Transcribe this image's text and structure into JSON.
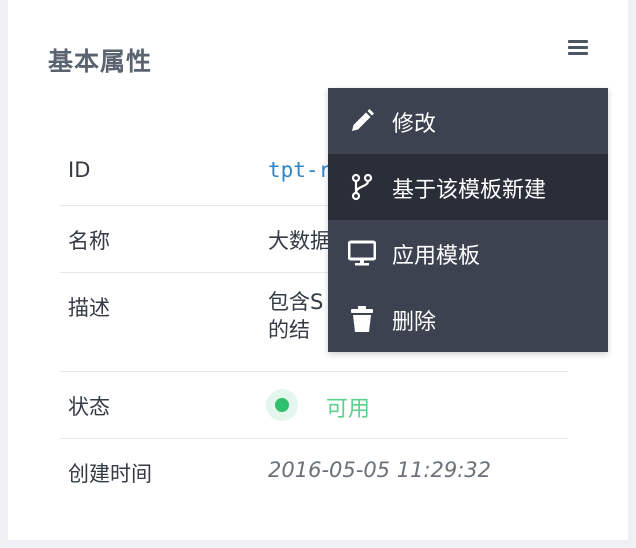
{
  "card": {
    "title": "基本属性",
    "menu_icon": "hamburger-menu-icon"
  },
  "properties": [
    {
      "label": "ID",
      "value": "tpt-r"
    },
    {
      "label": "名称",
      "value": "大数据"
    },
    {
      "label": "描述",
      "value": "包含S 端的结"
    },
    {
      "label": "状态",
      "value": "可用"
    },
    {
      "label": "创建时间",
      "value": "2016-05-05 11:29:32"
    }
  ],
  "dropdown": {
    "items": [
      {
        "label": "修改",
        "icon": "pencil-icon"
      },
      {
        "label": "基于该模板新建",
        "icon": "branch-icon"
      },
      {
        "label": "应用模板",
        "icon": "monitor-icon"
      },
      {
        "label": "删除",
        "icon": "trash-icon"
      }
    ]
  },
  "colors": {
    "status_available": "#2ec06d",
    "dropdown_bg": "#3d4250",
    "dropdown_active_bg": "#2a2e39",
    "id_text": "#2f86c8"
  }
}
